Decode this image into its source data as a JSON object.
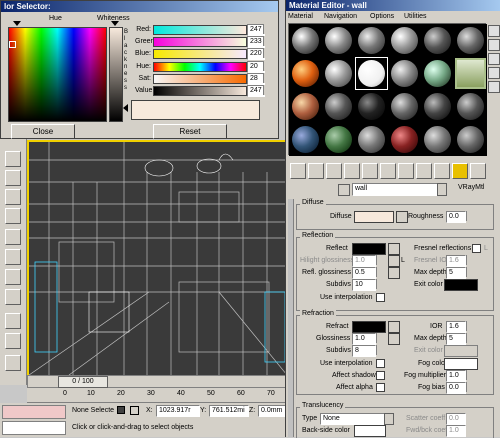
{
  "color_selector": {
    "title": "lor Selector:",
    "hue_label": "Hue",
    "whiteness_label": "Whiteness",
    "blackness_label": "B\nl\na\nc\nk\nn\ne\ns\ns",
    "rows": [
      {
        "label": "Red:",
        "value": "247"
      },
      {
        "label": "Green:",
        "value": "233"
      },
      {
        "label": "Blue:",
        "value": "220"
      },
      {
        "label": "Hue:",
        "value": "20"
      },
      {
        "label": "Sat:",
        "value": "28"
      },
      {
        "label": "Value:",
        "value": "247"
      }
    ],
    "close_label": "Close",
    "reset_label": "Reset",
    "swatch_color": "#f7e9dc"
  },
  "viewport": {
    "frame_counter": "0 / 100",
    "ruler_ticks": [
      "0",
      "10",
      "20",
      "30",
      "40",
      "50",
      "60",
      "70"
    ]
  },
  "status_bar": {
    "selection": "None Selecte",
    "x_label": "X:",
    "x_value": "1023.917r",
    "y_label": "Y:",
    "y_value": "761.512mi",
    "z_label": "Z:",
    "z_value": "0.0mm",
    "prompt": "Click or click-and-drag to select objects"
  },
  "material_editor": {
    "title": "Material Editor - wall",
    "menu": [
      "Material",
      "Navigation",
      "Options",
      "Utilities"
    ],
    "material_name": "wall",
    "material_type": "VRayMtl",
    "diffuse": {
      "group_title": "Diffuse",
      "diffuse_label": "Diffuse",
      "roughness_label": "Roughness",
      "roughness_value": "0.0"
    },
    "reflection": {
      "group_title": "Reflection",
      "reflect_label": "Reflect",
      "hilight_label": "Hilight glossiness",
      "hilight_value": "1.0",
      "refl_gloss_label": "Refl. glossiness",
      "refl_gloss_value": "0.5",
      "subdivs_label": "Subdivs",
      "subdivs_value": "10",
      "interp_label": "Use interpolation",
      "fresnel_label": "Fresnel reflections",
      "fresnel_ior_label": "Fresnel IOR",
      "fresnel_ior_value": "1.6",
      "max_depth_label": "Max depth",
      "max_depth_value": "5",
      "exit_color_label": "Exit color",
      "l_label": "L"
    },
    "refraction": {
      "group_title": "Refraction",
      "refract_label": "Refract",
      "glossiness_label": "Glossiness",
      "glossiness_value": "1.0",
      "subdivs_label": "Subdivs",
      "subdivs_value": "8",
      "interp_label": "Use interpolation",
      "shadows_label": "Affect shadows",
      "alpha_label": "Affect alpha",
      "ior_label": "IOR",
      "ior_value": "1.6",
      "max_depth_label": "Max depth",
      "max_depth_value": "5",
      "exit_color_label": "Exit color",
      "fog_color_label": "Fog color",
      "fog_mult_label": "Fog multiplier",
      "fog_mult_value": "1.0",
      "fog_bias_label": "Fog bias",
      "fog_bias_value": "0.0"
    },
    "translucency": {
      "group_title": "Translucency",
      "type_label": "Type",
      "type_value": "None",
      "back_label": "Back-side color",
      "scatter_label": "Scatter coeff",
      "scatter_value": "0.0",
      "fwd_label": "Fwd/bck coeff",
      "fwd_value": "1.0"
    }
  },
  "colors": {
    "diffuse_swatch": "#f7e9dc",
    "black_swatch": "#000000",
    "title_bar": "#0a246a",
    "wireframe_bg": "#3a3a3a",
    "viewport_border": "#f0d000"
  }
}
